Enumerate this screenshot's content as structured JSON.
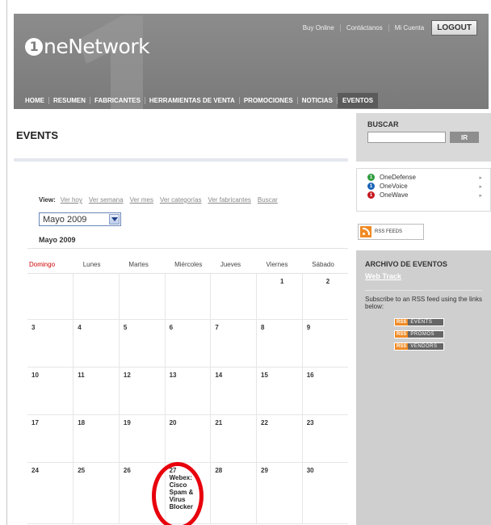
{
  "header": {
    "logo_text": "neNetwork",
    "logo_mark": "1",
    "top_links": [
      "Buy Online",
      "Contáctanos",
      "Mi Cuenta"
    ],
    "logout": "LOGOUT"
  },
  "nav": [
    "HOME",
    "RESUMEN",
    "FABRICANTES",
    "HERRAMIENTAS DE VENTA",
    "PROMOCIONES",
    "NOTICIAS",
    "EVENTOS"
  ],
  "nav_active": "EVENTOS",
  "main": {
    "title": "EVENTS",
    "view_label": "View:",
    "view_links": [
      "Ver hoy",
      "Ver semana",
      "Ver mes",
      "Ver categorías",
      "Ver fabricantes",
      "Buscar"
    ],
    "month_select": "Mayo  2009",
    "month_label": "Mayo 2009"
  },
  "calendar": {
    "weekdays": [
      "Domingo",
      "Lunes",
      "Martes",
      "Miércoles",
      "Jueves",
      "Viernes",
      "Sábado"
    ],
    "weeks": [
      [
        "",
        "",
        "",
        "",
        "",
        "1",
        "2"
      ],
      [
        "3",
        "4",
        "5",
        "6",
        "7",
        "8",
        "9"
      ],
      [
        "10",
        "11",
        "12",
        "13",
        "14",
        "15",
        "16"
      ],
      [
        "17",
        "18",
        "19",
        "20",
        "21",
        "22",
        "23"
      ],
      [
        "24",
        "25",
        "26",
        "27",
        "28",
        "29",
        "30"
      ]
    ],
    "event": {
      "day": "27",
      "title": "Webex: Cisco Spam & Virus Blocker"
    }
  },
  "sidebar": {
    "search_label": "BUSCAR",
    "search_button": "IR",
    "products": [
      {
        "name": "OneDefense",
        "color": "#2e9b3c"
      },
      {
        "name": "OneVoice",
        "color": "#1a63b8"
      },
      {
        "name": "OneWave",
        "color": "#c4161c"
      }
    ],
    "rss_feeds": "RSS FEEDS",
    "archive_title": "ARCHIVO DE EVENTOS",
    "web_track": "Web Track",
    "subscribe_text": "Subscribe to an RSS feed using the links below:",
    "feeds": [
      {
        "rss": "RSS",
        "label": "EVENTS"
      },
      {
        "rss": "RSS",
        "label": "PROMOS"
      },
      {
        "rss": "RSS",
        "label": "VENDORS"
      }
    ]
  },
  "colors": {
    "header_gray": "#858585",
    "highlight_circle": "#e8000c",
    "accent_red": "#cc0000",
    "rss_orange": "#f08a24"
  }
}
